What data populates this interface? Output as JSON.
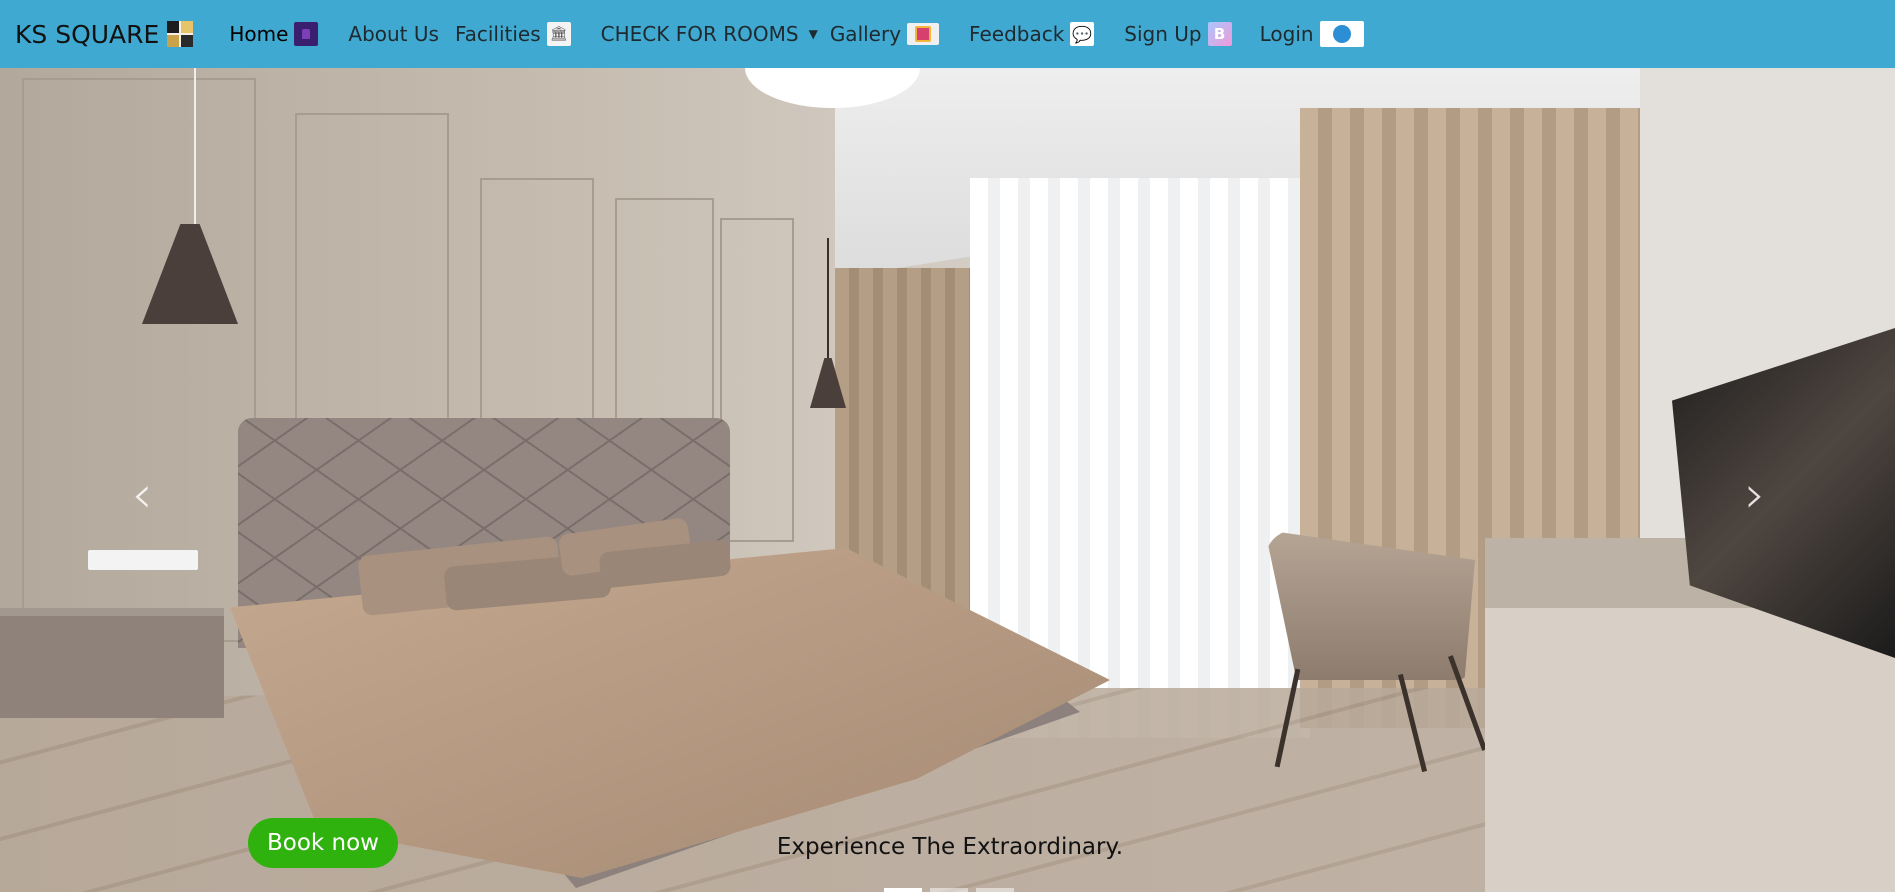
{
  "navbar": {
    "brand": "KS SQUARE",
    "items": [
      {
        "label": "Home",
        "icon": "home-icon"
      },
      {
        "label": "About Us"
      },
      {
        "label": "Facilities",
        "icon": "building-icon"
      },
      {
        "label": "CHECK FOR ROOMS",
        "icon": "caret-down-icon"
      },
      {
        "label": "Gallery",
        "icon": "gallery-icon"
      },
      {
        "label": "Feedback",
        "icon": "chat-icon"
      },
      {
        "label": "Sign Up",
        "icon": "signup-icon"
      },
      {
        "label": "Login",
        "icon": "user-icon"
      }
    ],
    "background": "#3fa9d1"
  },
  "hero": {
    "book_label": "Book now",
    "caption": "Experience The Extraordinary.",
    "prev_glyph": "‹",
    "next_glyph": "›",
    "slide_count": 3,
    "active_slide": 1
  },
  "colors": {
    "book_button": "#2fb10e"
  }
}
